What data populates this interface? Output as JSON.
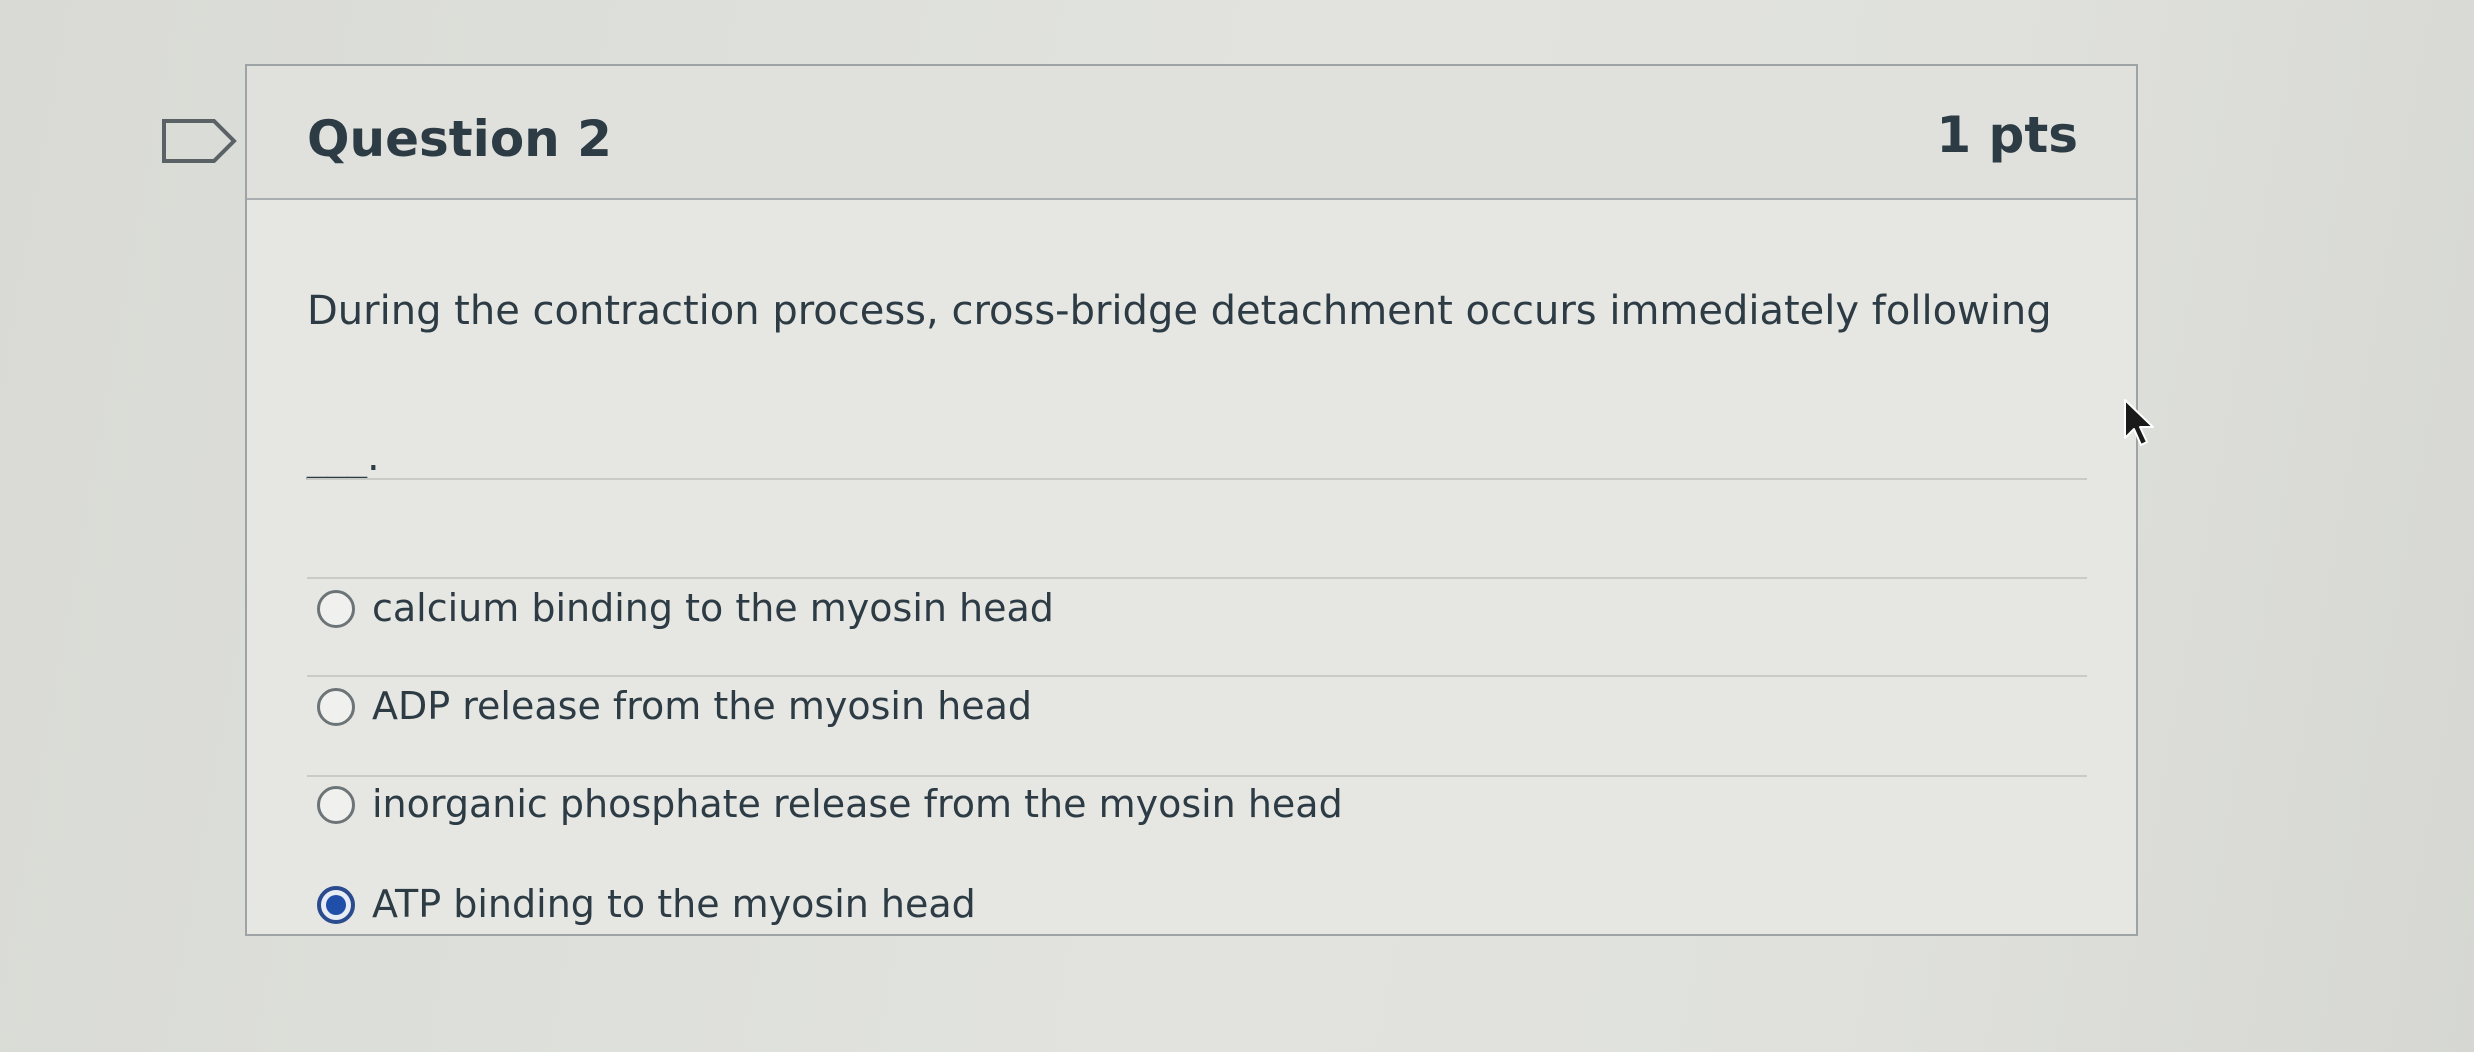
{
  "question": {
    "title": "Question 2",
    "points": "1 pts",
    "text": "During the contraction process, cross-bridge detachment occurs immediately following",
    "blank": "___."
  },
  "answers": [
    {
      "label": "calcium binding to the myosin head",
      "selected": false
    },
    {
      "label": "ADP release from the myosin head",
      "selected": false
    },
    {
      "label": "inorganic phosphate release from the myosin head",
      "selected": false
    },
    {
      "label": "ATP binding to the myosin head",
      "selected": true
    }
  ],
  "icons": {
    "flag": "flag-question-icon",
    "cursor": "mouse-pointer-icon"
  },
  "colors": {
    "selected_radio": "#1f4fa8",
    "text": "#2d3b45"
  }
}
